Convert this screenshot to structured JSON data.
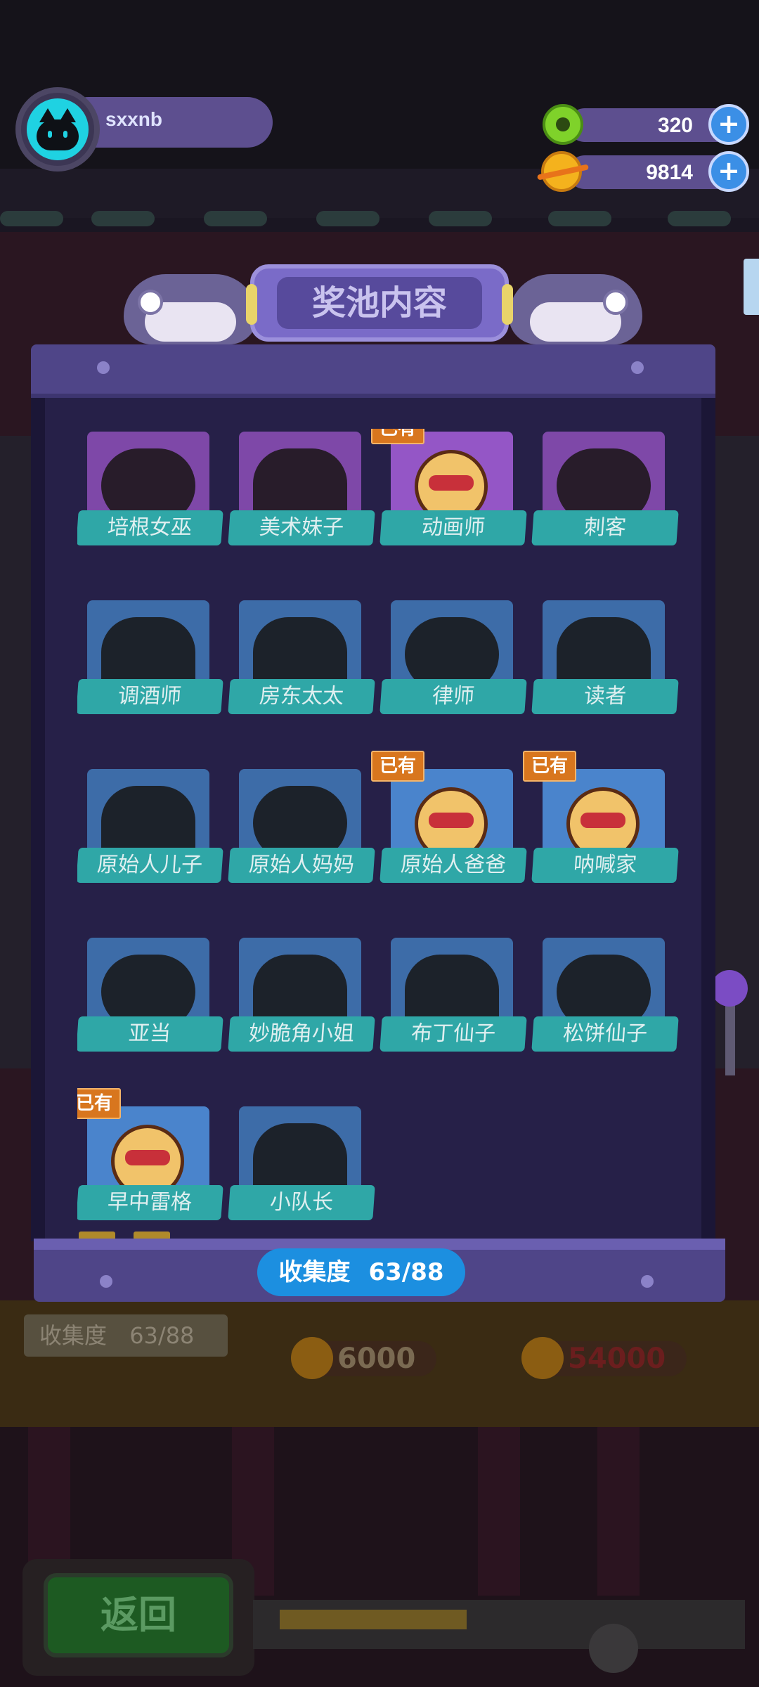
{
  "hud": {
    "username": "sxxnb",
    "currencies": [
      {
        "icon": "donut-coin-icon",
        "value": "320"
      },
      {
        "icon": "planet-coin-icon",
        "value": "9814"
      }
    ]
  },
  "panel": {
    "title": "奖池内容",
    "owned_badge": "已有",
    "characters": [
      {
        "name": "培根女巫",
        "owned": false,
        "frame": "purple"
      },
      {
        "name": "美术妹子",
        "owned": false,
        "frame": "purple"
      },
      {
        "name": "动画师",
        "owned": true,
        "frame": "purple"
      },
      {
        "name": "刺客",
        "owned": false,
        "frame": "purple"
      },
      {
        "name": "调酒师",
        "owned": false,
        "frame": "blue"
      },
      {
        "name": "房东太太",
        "owned": false,
        "frame": "blue"
      },
      {
        "name": "律师",
        "owned": false,
        "frame": "blue"
      },
      {
        "name": "读者",
        "owned": false,
        "frame": "blue"
      },
      {
        "name": "原始人儿子",
        "owned": false,
        "frame": "blue"
      },
      {
        "name": "原始人妈妈",
        "owned": false,
        "frame": "blue"
      },
      {
        "name": "原始人爸爸",
        "owned": true,
        "frame": "blue"
      },
      {
        "name": "呐喊家",
        "owned": true,
        "frame": "blue"
      },
      {
        "name": "亚当",
        "owned": false,
        "frame": "blue"
      },
      {
        "name": "妙脆角小姐",
        "owned": false,
        "frame": "blue"
      },
      {
        "name": "布丁仙子",
        "owned": false,
        "frame": "blue"
      },
      {
        "name": "松饼仙子",
        "owned": false,
        "frame": "blue"
      },
      {
        "name": "早中雷格",
        "owned": true,
        "frame": "blue"
      },
      {
        "name": "小队长",
        "owned": false,
        "frame": "blue"
      }
    ],
    "collection_label": "收集度",
    "collection_value": "63/88"
  },
  "background": {
    "collection_label": "收集度",
    "collection_value": "63/88",
    "prices": [
      "6000",
      "54000"
    ],
    "back_button": "返回"
  },
  "colors": {
    "panel": "#262048",
    "frame_purple": "#7e48a8",
    "frame_blue": "#3d6ca8",
    "label_teal": "#2fa7a7",
    "owned_badge": "#d8761e",
    "collect_pill": "#1c8fe0"
  }
}
